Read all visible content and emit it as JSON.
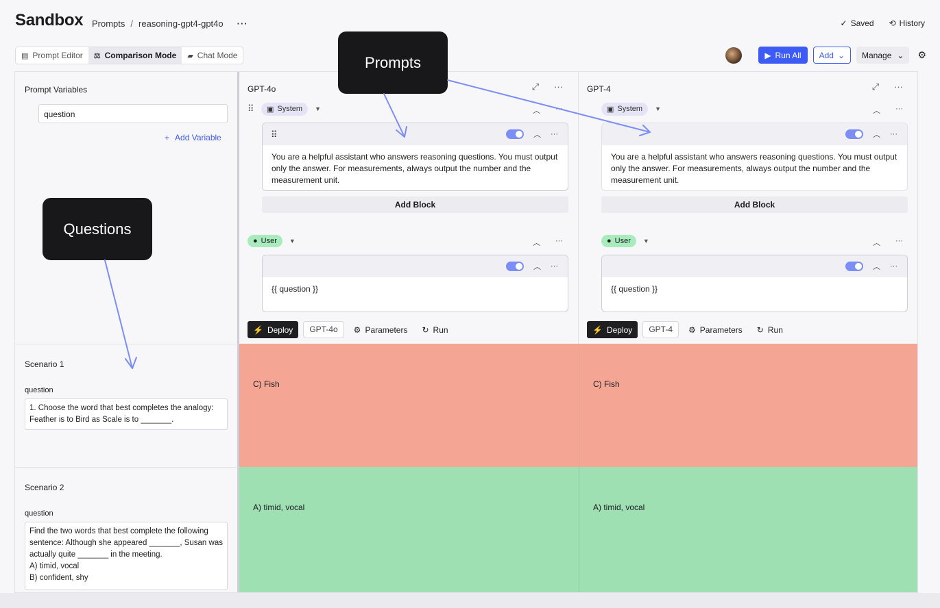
{
  "app": {
    "title": "Sandbox"
  },
  "breadcrumb": {
    "root": "Prompts",
    "sep": "/",
    "current": "reasoning-gpt4-gpt4o",
    "more": "···"
  },
  "status": {
    "saved": "Saved",
    "history": "History"
  },
  "modes": [
    {
      "label": "Prompt Editor",
      "icon": "document-icon",
      "active": false
    },
    {
      "label": "Comparison Mode",
      "icon": "scale-icon",
      "active": true
    },
    {
      "label": "Chat Mode",
      "icon": "chat-icon",
      "active": false
    }
  ],
  "actions": {
    "run_all": "Run All",
    "add": "Add",
    "manage": "Manage"
  },
  "variables": {
    "title": "Prompt Variables",
    "items": [
      "question"
    ],
    "add_label": "Add Variable"
  },
  "columns": [
    {
      "title": "GPT-4o",
      "system_role": "System",
      "system_text": "You are a helpful assistant who answers reasoning questions. You must output only the answer. For measurements, always output the number and the measurement unit.",
      "add_block": "Add Block",
      "user_role": "User",
      "user_text": "{{ question }}",
      "deploy": "Deploy",
      "model": "GPT-4o",
      "parameters": "Parameters",
      "run": "Run"
    },
    {
      "title": "GPT-4",
      "system_role": "System",
      "system_text": "You are a helpful assistant who answers reasoning questions. You must output only the answer. For measurements, always output the number and the measurement unit.",
      "add_block": "Add Block",
      "user_role": "User",
      "user_text": "{{ question }}",
      "deploy": "Deploy",
      "model": "GPT-4",
      "parameters": "Parameters",
      "run": "Run"
    }
  ],
  "scenarios": [
    {
      "title": "Scenario 1",
      "var_label": "question",
      "lines": [
        "1. Choose the word that best completes the analogy:",
        "Feather is to Bird as Scale is to _______."
      ],
      "results": [
        "C) Fish",
        "C) Fish"
      ],
      "status_color": "#f5a594"
    },
    {
      "title": "Scenario 2",
      "var_label": "question",
      "lines": [
        "Find the two words that best complete the following",
        "sentence: Although she appeared _______, Susan was",
        "actually quite _______ in the meeting.",
        "A) timid, vocal",
        "B) confident, shy"
      ],
      "results": [
        "A) timid, vocal",
        "A) timid, vocal"
      ],
      "status_color": "#9fe0b2"
    }
  ],
  "annotations": {
    "prompts": "Prompts",
    "questions": "Questions",
    "arrow_color": "#7b8ef5"
  },
  "colors": {
    "accent": "#3d5bf5",
    "fail": "#f5a594",
    "pass": "#9fe0b2",
    "user_chip": "#a8ebbd",
    "system_chip": "#e5e4f6"
  }
}
